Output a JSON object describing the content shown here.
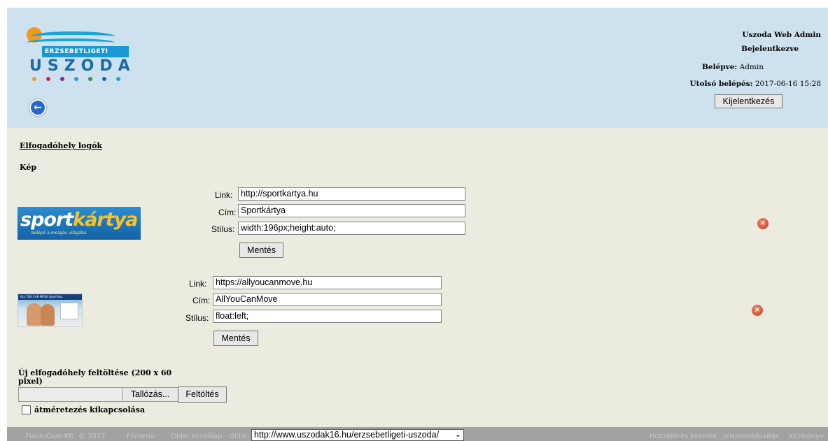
{
  "header": {
    "logo": {
      "top_text": "ERZSEBETLIGETI",
      "main_text": "USZODA",
      "dot_colors": [
        "#f39a1d",
        "#d8263b",
        "#7b2f8d",
        "#1fa3dc",
        "#2c9a45",
        "#1b6aa8",
        "#1fa3dc"
      ]
    },
    "back_icon_glyph": "←",
    "admin": {
      "title": "Uszoda Web Admin",
      "status": "Bejelentkezve",
      "user_label": "Belépve:",
      "user_value": "Admin",
      "last_label": "Utolsó belépés:",
      "last_value": "2017-06-16 15:28",
      "logout_label": "Kijelentkezés"
    }
  },
  "main": {
    "section_title": "Elfogadóhely logók",
    "column_header": "Kép",
    "entries": [
      {
        "logo_text_a": "sport",
        "logo_text_b": "kártya",
        "logo_tagline": "belépő a mozgás világába",
        "link_label": "Link:",
        "link_value": "http://sportkartya.hu",
        "title_label": "Cím:",
        "title_value": "Sportkártya",
        "style_label": "Stílus:",
        "style_value": "width:196px;height:auto;",
        "save_label": "Mentés",
        "delete_glyph": "×"
      },
      {
        "logo_text": "ALL YOU CAN MOVE SportPass",
        "link_label": "Link:",
        "link_value": "https://allyoucanmove.hu",
        "title_label": "Cím:",
        "title_value": "AllYouCanMove",
        "style_label": "Stílus:",
        "style_value": "float:left;",
        "save_label": "Mentés",
        "delete_glyph": "×"
      }
    ],
    "upload": {
      "title": "Új elfogadóhely feltöltése (200 x 60 pixel)",
      "browse_label": "Tallózás...",
      "upload_label": "Feltöltés",
      "resize_label": "átméretezés kikapcsolása"
    }
  },
  "footer": {
    "copyright": "Flash-Com Kft. © 2017.",
    "menu": "Főmenü",
    "home": "Oldal kezdőlap",
    "page_label": "Oldal:",
    "page_value": "http://www.uszodak16.hu/erzsebetligeti-uszoda/",
    "access": "Hozzáférés kezelés",
    "password": "Jelszómódosítás",
    "manual": "Kézikönyv"
  }
}
